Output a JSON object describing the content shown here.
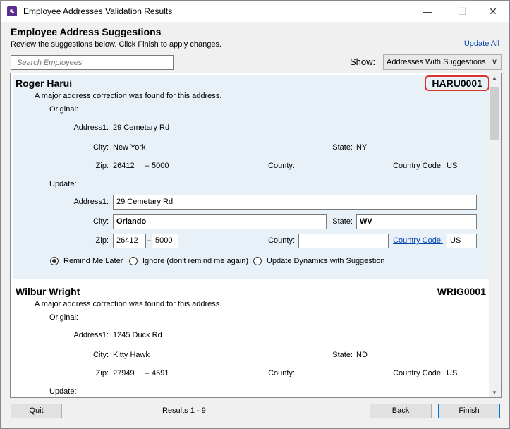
{
  "window": {
    "title": "Employee Addresses Validation Results",
    "icon": "app-logo-icon",
    "minimize_glyph": "—",
    "maximize_glyph": "☐",
    "close_glyph": "✕"
  },
  "header": {
    "title": "Employee Address Suggestions",
    "subtitle": "Review the suggestions below. Click Finish to apply changes.",
    "update_all": "Update All"
  },
  "search": {
    "placeholder": "Search Employees"
  },
  "filter": {
    "label": "Show:",
    "selected": "Addresses With Suggestions"
  },
  "labels": {
    "original": "Original:",
    "update": "Update:",
    "address1": "Address1:",
    "city": "City:",
    "state": "State:",
    "zip": "Zip:",
    "county": "County:",
    "country_code": "Country Code:",
    "zip_sep": "–"
  },
  "options": {
    "remind": "Remind Me Later",
    "ignore": "Ignore (don't remind me again)",
    "update": "Update Dynamics with Suggestion"
  },
  "employees": [
    {
      "name": "Roger Harui",
      "id": "HARU0001",
      "message": "A major address correction was found for this address.",
      "original": {
        "address1": "29 Cemetary Rd",
        "city": "New York",
        "state": "NY",
        "zip": "26412",
        "zip_ext": "5000",
        "county": "",
        "country_code": "US"
      },
      "update": {
        "address1": "29 Cemetary Rd",
        "city": "Orlando",
        "state": "WV",
        "zip": "26412",
        "zip_ext": "5000",
        "county": "",
        "country_code": "US"
      },
      "selected_option": "remind"
    },
    {
      "name": "Wilbur Wright",
      "id": "WRIG0001",
      "message": "A major address correction was found for this address.",
      "original": {
        "address1": "1245 Duck Rd",
        "city": "Kitty Hawk",
        "state": "ND",
        "zip": "27949",
        "zip_ext": "4591",
        "county": "",
        "country_code": "US"
      }
    }
  ],
  "footer": {
    "quit": "Quit",
    "results": "Results 1 - 9",
    "back": "Back",
    "finish": "Finish"
  }
}
